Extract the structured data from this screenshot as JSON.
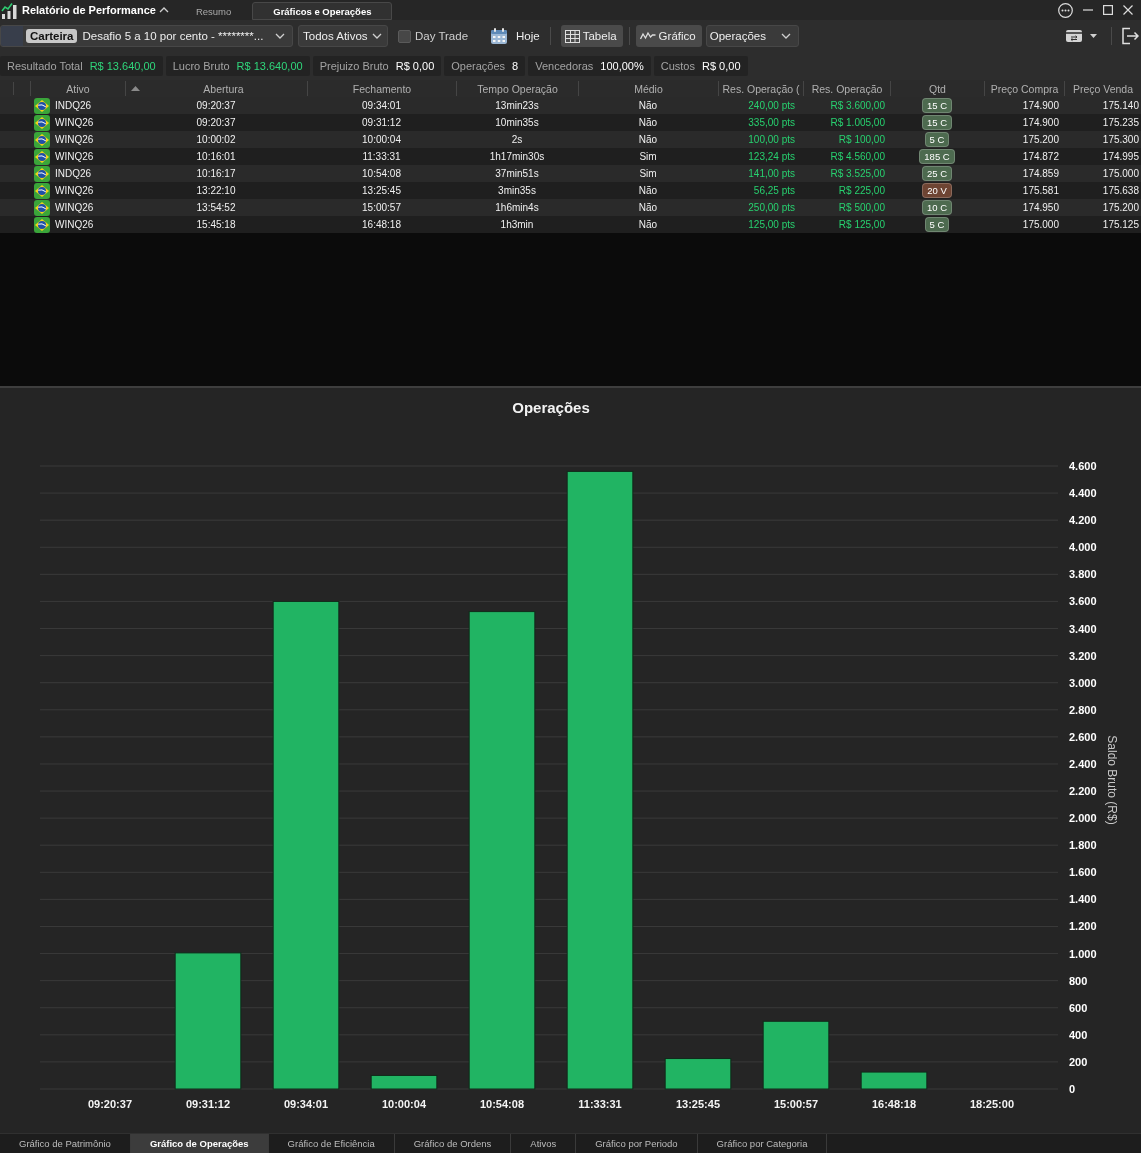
{
  "title_bar": {
    "title": "Relatório de Performance",
    "tabs": [
      {
        "label": "Resumo",
        "selected": false
      },
      {
        "label": "Gráficos e Operações",
        "selected": true
      }
    ]
  },
  "toolbar": {
    "portfolio": {
      "tag": "Carteira",
      "value": "Desafio 5 a 10 por cento - ********..."
    },
    "asset_filter": "Todos Ativos",
    "day_trade": {
      "label": "Day Trade",
      "checked": false
    },
    "date_button": "Hoje",
    "views": [
      {
        "label": "Tabela",
        "kind": "table",
        "selected": true
      },
      {
        "label": "Gráfico",
        "kind": "chart",
        "selected": true
      }
    ],
    "chart_selector": "Operações"
  },
  "summary": [
    {
      "label": "Resultado Total",
      "value": "R$ 13.640,00",
      "kind": "gain"
    },
    {
      "label": "Lucro Bruto",
      "value": "R$ 13.640,00",
      "kind": "gain"
    },
    {
      "label": "Prejuizo Bruto",
      "value": "R$ 0,00",
      "kind": "plain"
    },
    {
      "label": "Operações",
      "value": "8",
      "kind": "plain"
    },
    {
      "label": "Vencedoras",
      "value": "100,00%",
      "kind": "plain"
    },
    {
      "label": "Custos",
      "value": "R$ 0,00",
      "kind": "plain"
    }
  ],
  "table": {
    "columns": [
      {
        "label": "Ativo",
        "sorted": false
      },
      {
        "label": "Abertura",
        "sorted": true
      },
      {
        "label": "Fechamento",
        "sorted": false
      },
      {
        "label": "Tempo Operação",
        "sorted": false
      },
      {
        "label": "Médio",
        "sorted": false
      },
      {
        "label": "Res. Operação (",
        "sorted": false
      },
      {
        "label": "Res. Operação",
        "sorted": false
      },
      {
        "label": "Qtd",
        "sorted": false
      },
      {
        "label": "Preço Compra",
        "sorted": false
      },
      {
        "label": "Preço Venda",
        "sorted": false
      }
    ],
    "rows": [
      {
        "asset": "INDQ26",
        "open": "09:20:37",
        "close": "09:34:01",
        "duration": "13min23s",
        "average": "Não",
        "result_points": "240,00 pts",
        "result_money": "R$ 3.600,00",
        "quantity": {
          "label": "15 C",
          "color": "#4d6a4f"
        },
        "buy_price": "174.900",
        "sell_price": "175.140"
      },
      {
        "asset": "WINQ26",
        "open": "09:20:37",
        "close": "09:31:12",
        "duration": "10min35s",
        "average": "Não",
        "result_points": "335,00 pts",
        "result_money": "R$ 1.005,00",
        "quantity": {
          "label": "15 C",
          "color": "#4d6a4f"
        },
        "buy_price": "174.900",
        "sell_price": "175.235"
      },
      {
        "asset": "WINQ26",
        "open": "10:00:02",
        "close": "10:00:04",
        "duration": "2s",
        "average": "Não",
        "result_points": "100,00 pts",
        "result_money": "R$ 100,00",
        "quantity": {
          "label": "5 C",
          "color": "#4d6a4f"
        },
        "buy_price": "175.200",
        "sell_price": "175.300"
      },
      {
        "asset": "WINQ26",
        "open": "10:16:01",
        "close": "11:33:31",
        "duration": "1h17min30s",
        "average": "Sim",
        "result_points": "123,24 pts",
        "result_money": "R$ 4.560,00",
        "quantity": {
          "label": "185 C",
          "color": "#4d6a4f"
        },
        "buy_price": "174.872",
        "sell_price": "174.995"
      },
      {
        "asset": "INDQ26",
        "open": "10:16:17",
        "close": "10:54:08",
        "duration": "37min51s",
        "average": "Sim",
        "result_points": "141,00 pts",
        "result_money": "R$ 3.525,00",
        "quantity": {
          "label": "25 C",
          "color": "#4d6a4f"
        },
        "buy_price": "174.859",
        "sell_price": "175.000"
      },
      {
        "asset": "WINQ26",
        "open": "13:22:10",
        "close": "13:25:45",
        "duration": "3min35s",
        "average": "Não",
        "result_points": "56,25 pts",
        "result_money": "R$ 225,00",
        "quantity": {
          "label": "20 V",
          "color": "#6e4433"
        },
        "buy_price": "175.581",
        "sell_price": "175.638"
      },
      {
        "asset": "WINQ26",
        "open": "13:54:52",
        "close": "15:00:57",
        "duration": "1h6min4s",
        "average": "Não",
        "result_points": "250,00 pts",
        "result_money": "R$ 500,00",
        "quantity": {
          "label": "10 C",
          "color": "#4d6a4f"
        },
        "buy_price": "174.950",
        "sell_price": "175.200"
      },
      {
        "asset": "WINQ26",
        "open": "15:45:18",
        "close": "16:48:18",
        "duration": "1h3min",
        "average": "Não",
        "result_points": "125,00 pts",
        "result_money": "R$ 125,00",
        "quantity": {
          "label": "5 C",
          "color": "#4d6a4f"
        },
        "buy_price": "175.000",
        "sell_price": "175.125"
      }
    ]
  },
  "chart": {
    "chart_data": {
      "type": "bar",
      "title": "Operações",
      "ylabel": "Saldo Bruto (R$)",
      "categories": [
        "09:20:37",
        "09:31:12",
        "09:34:01",
        "10:00:04",
        "10:54:08",
        "11:33:31",
        "13:25:45",
        "15:00:57",
        "16:48:18",
        "18:25:00"
      ],
      "values": [
        null,
        1005,
        3600,
        100,
        3525,
        4560,
        225,
        500,
        125,
        null
      ],
      "ylim": [
        0,
        4600
      ],
      "grid": true,
      "yticks": [
        0,
        200,
        400,
        600,
        800,
        {
          "value": 1000,
          "label": "1.000"
        },
        {
          "value": 1200,
          "label": "1.200"
        },
        {
          "value": 1400,
          "label": "1.400"
        },
        {
          "value": 1600,
          "label": "1.600"
        },
        {
          "value": 1800,
          "label": "1.800"
        },
        {
          "value": 2000,
          "label": "2.000"
        },
        {
          "value": 2200,
          "label": "2.200"
        },
        {
          "value": 2400,
          "label": "2.400"
        },
        {
          "value": 2600,
          "label": "2.600"
        },
        {
          "value": 2800,
          "label": "2.800"
        },
        {
          "value": 3000,
          "label": "3.000"
        },
        {
          "value": 3200,
          "label": "3.200"
        },
        {
          "value": 3400,
          "label": "3.400"
        },
        {
          "value": 3600,
          "label": "3.600"
        },
        {
          "value": 3800,
          "label": "3.800"
        },
        {
          "value": 4000,
          "label": "4.000"
        },
        {
          "value": 4200,
          "label": "4.200"
        },
        {
          "value": 4400,
          "label": "4.400"
        },
        {
          "value": 4600,
          "label": "4.600"
        }
      ]
    }
  },
  "bottom_tabs": [
    {
      "label": "Gráfico de Patrimônio",
      "selected": false
    },
    {
      "label": "Gráfico de Operações",
      "selected": true
    },
    {
      "label": "Gráfico de Eficiência",
      "selected": false
    },
    {
      "label": "Gráfico de Ordens",
      "selected": false
    },
    {
      "label": "Ativos",
      "selected": false
    },
    {
      "label": "Gráfico por Periodo",
      "selected": false
    },
    {
      "label": "Gráfico por Categoria",
      "selected": false
    }
  ]
}
